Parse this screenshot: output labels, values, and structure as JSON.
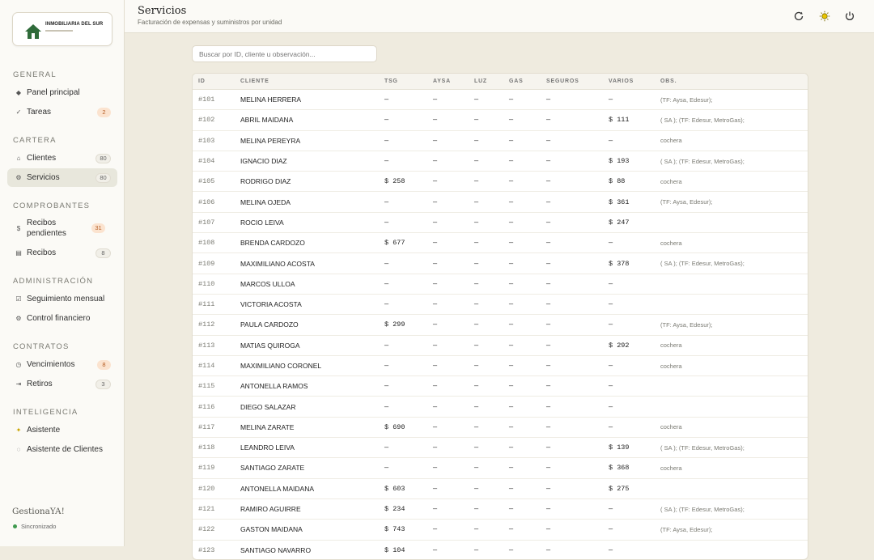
{
  "sidebar": {
    "logo": {
      "name": "INMOBILIARIA DEL SUR"
    },
    "sections": {
      "general": "GENERAL",
      "cartera": "CARTERA",
      "comprobantes": "COMPROBANTES",
      "administracion": "ADMINISTRACIÓN",
      "contratos": "CONTRATOS",
      "inteligencia": "INTELIGENCIA"
    },
    "items": {
      "panel": {
        "label": "Panel principal",
        "icon": "diamond-icon"
      },
      "tareas": {
        "label": "Tareas",
        "badge": "2",
        "icon": "check-icon"
      },
      "clientes": {
        "label": "Clientes",
        "badge": "80",
        "icon": "home-icon"
      },
      "servicios": {
        "label": "Servicios",
        "badge": "80",
        "icon": "settings-icon"
      },
      "recibos_pendientes": {
        "label": "Recibos pendientes",
        "badge": "31",
        "icon": "dollar-icon"
      },
      "recibos": {
        "label": "Recibos",
        "badge": "8",
        "icon": "receipt-icon"
      },
      "seguimiento": {
        "label": "Seguimiento mensual",
        "icon": "checkbox-icon"
      },
      "control": {
        "label": "Control financiero",
        "icon": "gear-icon"
      },
      "vencimientos": {
        "label": "Vencimientos",
        "badge": "8",
        "icon": "clock-icon"
      },
      "retiros": {
        "label": "Retiros",
        "badge": "3",
        "icon": "exit-icon"
      },
      "asistente": {
        "label": "Asistente",
        "icon": "sparkle-icon"
      },
      "asistente_clientes": {
        "label": "Asistente de Clientes",
        "icon": "chat-icon"
      }
    },
    "brand": "GestionaYA!",
    "status": "Sincronizado"
  },
  "header": {
    "title": "Servicios",
    "subtitle": "Facturación de expensas y suministros por unidad",
    "icons": [
      "refresh-icon",
      "sun-icon",
      "power-icon"
    ]
  },
  "search": {
    "placeholder": "Buscar por ID, cliente u observación..."
  },
  "table": {
    "columns": [
      "ID",
      "CLIENTE",
      "TSG",
      "AYSA",
      "LUZ",
      "GAS",
      "SEGUROS",
      "VARIOS",
      "OBS."
    ],
    "rows": [
      [
        "#101",
        "MELINA HERRERA",
        "—",
        "—",
        "—",
        "—",
        "—",
        "—",
        "(TF: Aysa, Edesur);"
      ],
      [
        "#102",
        "ABRIL MAIDANA",
        "—",
        "—",
        "—",
        "—",
        "—",
        "$ 111",
        "( SA ); (TF: Edesur, MetroGas);"
      ],
      [
        "#103",
        "MELINA PEREYRA",
        "—",
        "—",
        "—",
        "—",
        "—",
        "—",
        "cochera"
      ],
      [
        "#104",
        "IGNACIO DIAZ",
        "—",
        "—",
        "—",
        "—",
        "—",
        "$ 193",
        "( SA ); (TF: Edesur, MetroGas);"
      ],
      [
        "#105",
        "RODRIGO DIAZ",
        "$ 258",
        "—",
        "—",
        "—",
        "—",
        "$ 88",
        "cochera"
      ],
      [
        "#106",
        "MELINA OJEDA",
        "—",
        "—",
        "—",
        "—",
        "—",
        "$ 361",
        "(TF: Aysa, Edesur);"
      ],
      [
        "#107",
        "ROCIO LEIVA",
        "—",
        "—",
        "—",
        "—",
        "—",
        "$ 247",
        ""
      ],
      [
        "#108",
        "BRENDA CARDOZO",
        "$ 677",
        "—",
        "—",
        "—",
        "—",
        "—",
        "cochera"
      ],
      [
        "#109",
        "MAXIMILIANO ACOSTA",
        "—",
        "—",
        "—",
        "—",
        "—",
        "$ 378",
        "( SA ); (TF: Edesur, MetroGas);"
      ],
      [
        "#110",
        "MARCOS ULLOA",
        "—",
        "—",
        "—",
        "—",
        "—",
        "—",
        ""
      ],
      [
        "#111",
        "VICTORIA ACOSTA",
        "—",
        "—",
        "—",
        "—",
        "—",
        "—",
        ""
      ],
      [
        "#112",
        "PAULA CARDOZO",
        "$ 299",
        "—",
        "—",
        "—",
        "—",
        "—",
        "(TF: Aysa, Edesur);"
      ],
      [
        "#113",
        "MATIAS QUIROGA",
        "—",
        "—",
        "—",
        "—",
        "—",
        "$ 292",
        "cochera"
      ],
      [
        "#114",
        "MAXIMILIANO CORONEL",
        "—",
        "—",
        "—",
        "—",
        "—",
        "—",
        "cochera"
      ],
      [
        "#115",
        "ANTONELLA RAMOS",
        "—",
        "—",
        "—",
        "—",
        "—",
        "—",
        ""
      ],
      [
        "#116",
        "DIEGO SALAZAR",
        "—",
        "—",
        "—",
        "—",
        "—",
        "—",
        ""
      ],
      [
        "#117",
        "MELINA ZARATE",
        "$ 690",
        "—",
        "—",
        "—",
        "—",
        "—",
        "cochera"
      ],
      [
        "#118",
        "LEANDRO LEIVA",
        "—",
        "—",
        "—",
        "—",
        "—",
        "$ 139",
        "( SA ); (TF: Edesur, MetroGas);"
      ],
      [
        "#119",
        "SANTIAGO ZARATE",
        "—",
        "—",
        "—",
        "—",
        "—",
        "$ 368",
        "cochera"
      ],
      [
        "#120",
        "ANTONELLA MAIDANA",
        "$ 603",
        "—",
        "—",
        "—",
        "—",
        "$ 275",
        ""
      ],
      [
        "#121",
        "RAMIRO AGUIRRE",
        "$ 234",
        "—",
        "—",
        "—",
        "—",
        "—",
        "( SA ); (TF: Edesur, MetroGas);"
      ],
      [
        "#122",
        "GASTON MAIDANA",
        "$ 743",
        "—",
        "—",
        "—",
        "—",
        "—",
        "(TF: Aysa, Edesur);"
      ],
      [
        "#123",
        "SANTIAGO NAVARRO",
        "$ 104",
        "—",
        "—",
        "—",
        "—",
        "—",
        ""
      ]
    ]
  },
  "colors": {
    "accent": "#2f6b3a",
    "badge_orange": "#fbe3cf",
    "background": "#efebdf"
  }
}
